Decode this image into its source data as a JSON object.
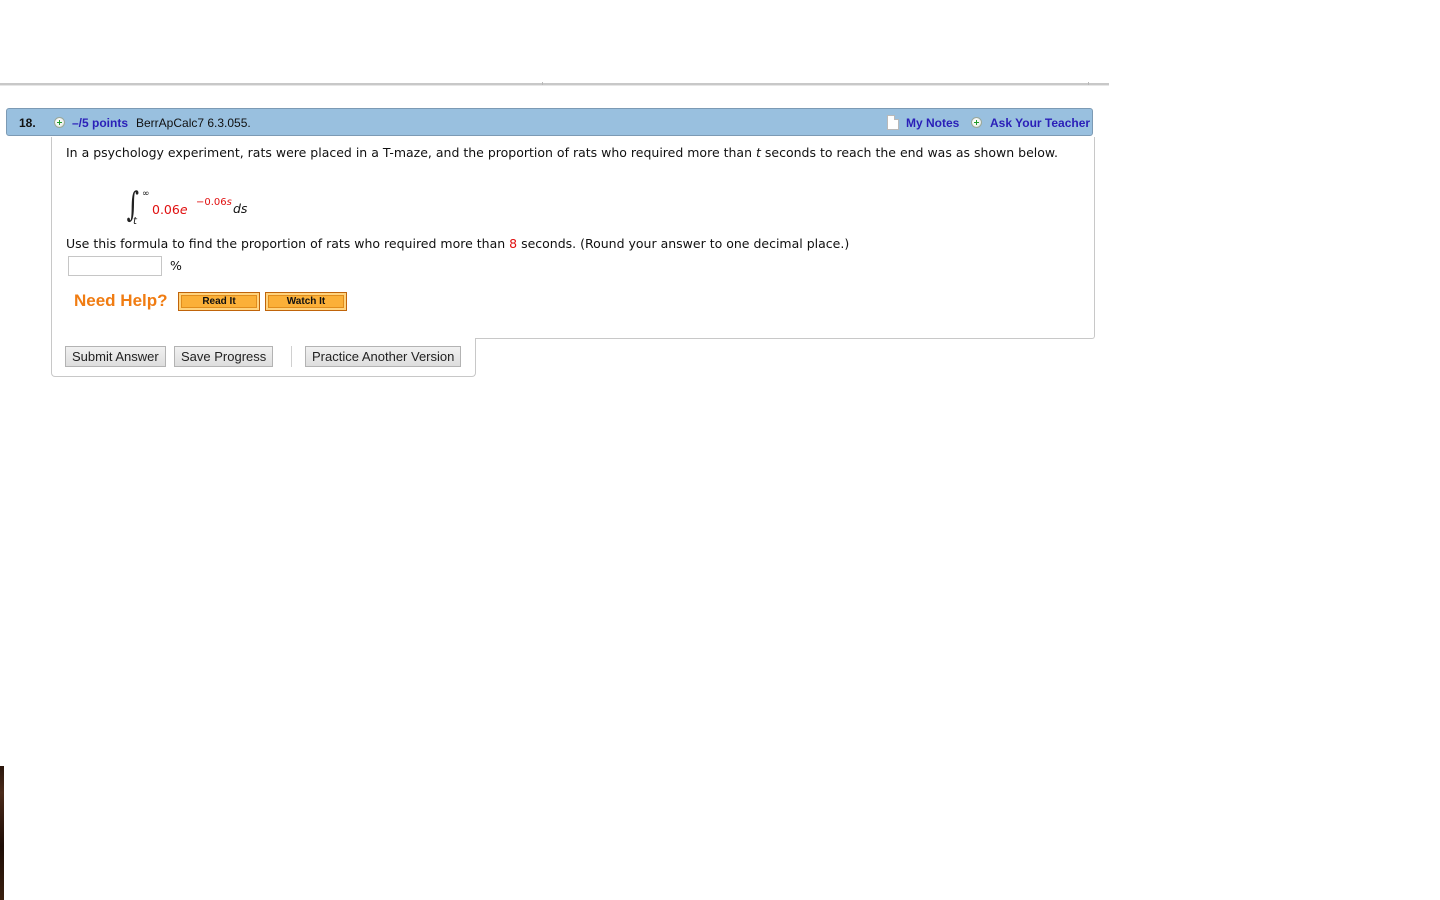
{
  "question": {
    "number": "18.",
    "points": "–/5 points",
    "reference": "BerrApCalc7 6.3.055.",
    "header_links": {
      "my_notes": "My Notes",
      "ask_teacher": "Ask Your Teacher"
    },
    "prompt_before_t": "In a psychology experiment, rats were placed in a T-maze, and the proportion of rats who required more than ",
    "prompt_var": "t",
    "prompt_after_t": " seconds to reach the end was as shown below.",
    "formula": {
      "upper_limit": "∞",
      "lower_limit": "t",
      "coefficient": "0.06",
      "base": "e",
      "exponent_prefix": "−0.06",
      "exponent_var": "s",
      "differential": "ds"
    },
    "instruction_before": "Use this formula to find the proportion of rats who required more than ",
    "instruction_value": "8",
    "instruction_after": " seconds. (Round your answer to one decimal place.)",
    "answer": {
      "value": "",
      "unit": "%"
    },
    "help": {
      "label": "Need Help?",
      "read_it": "Read It",
      "watch_it": "Watch It"
    },
    "actions": {
      "submit": "Submit Answer",
      "save": "Save Progress",
      "practice": "Practice Another Version"
    }
  },
  "colors": {
    "header_bg": "#99c0df",
    "link": "#2a1fb8",
    "highlight_red": "#e01010",
    "help_orange": "#f07c12",
    "help_button": "#fbb038"
  }
}
